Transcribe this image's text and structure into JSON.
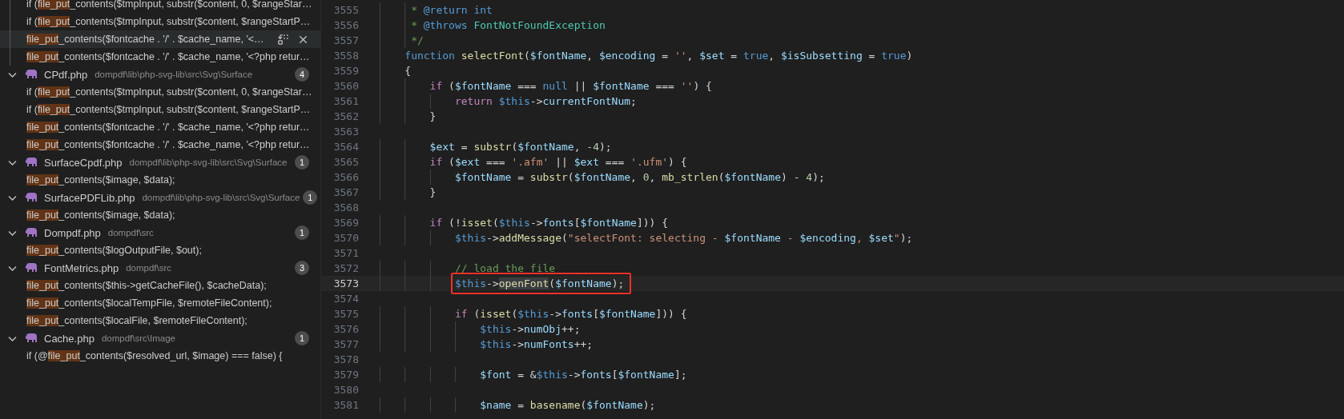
{
  "search_results": {
    "groups": [
      {
        "matches": [
          {
            "before": "if (",
            "match": "file_put",
            "after": "_contents($tmpInput, substr($content, 0, $rangeStar…",
            "selected": false
          },
          {
            "before": "if (",
            "match": "file_put",
            "after": "_contents($tmpInput, substr($content, $rangeStartP…",
            "selected": false
          },
          {
            "match": "file_put",
            "after": "_contents($fontcache . '/' . $cache_name, '<…",
            "selected": true
          },
          {
            "match": "file_put",
            "after": "_contents($fontcache . '/' . $cache_name, '<?php retur…",
            "selected": false
          }
        ]
      },
      {
        "file": "CPdf.php",
        "path": "dompdf\\lib\\php-svg-lib\\src\\Svg\\Surface",
        "count": "4",
        "expanded": true,
        "matches": [
          {
            "before": "if (",
            "match": "file_put",
            "after": "_contents($tmpInput, substr($content, 0, $rangeStar…",
            "selected": false
          },
          {
            "before": "if (",
            "match": "file_put",
            "after": "_contents($tmpInput, substr($content, $rangeStartP…",
            "selected": false
          },
          {
            "match": "file_put",
            "after": "_contents($fontcache . '/' . $cache_name, '<?php retur…",
            "selected": false
          },
          {
            "match": "file_put",
            "after": "_contents($fontcache . '/' . $cache_name, '<?php retur…",
            "selected": false
          }
        ]
      },
      {
        "file": "SurfaceCpdf.php",
        "path": "dompdf\\lib\\php-svg-lib\\src\\Svg\\Surface",
        "count": "1",
        "expanded": true,
        "matches": [
          {
            "match": "file_put",
            "after": "_contents($image, $data);",
            "selected": false
          }
        ]
      },
      {
        "file": "SurfacePDFLib.php",
        "path": "dompdf\\lib\\php-svg-lib\\src\\Svg\\Surface",
        "count": "1",
        "expanded": true,
        "matches": [
          {
            "match": "file_put",
            "after": "_contents($image, $data);",
            "selected": false
          }
        ]
      },
      {
        "file": "Dompdf.php",
        "path": "dompdf\\src",
        "count": "1",
        "expanded": true,
        "matches": [
          {
            "match": "file_put",
            "after": "_contents($logOutputFile, $out);",
            "selected": false
          }
        ]
      },
      {
        "file": "FontMetrics.php",
        "path": "dompdf\\src",
        "count": "3",
        "expanded": true,
        "matches": [
          {
            "match": "file_put",
            "after": "_contents($this->getCacheFile(), $cacheData);",
            "selected": false
          },
          {
            "match": "file_put",
            "after": "_contents($localTempFile, $remoteFileContent);",
            "selected": false
          },
          {
            "match": "file_put",
            "after": "_contents($localFile, $remoteFileContent);",
            "selected": false
          }
        ]
      },
      {
        "file": "Cache.php",
        "path": "dompdf\\src\\Image",
        "count": "1",
        "expanded": true,
        "matches": [
          {
            "before": "if (@",
            "match": "file_put",
            "after": "_contents($resolved_url, $image) === false) {",
            "selected": false
          }
        ]
      }
    ]
  },
  "editor": {
    "lines": [
      {
        "number": "3555",
        "current": false,
        "annotated": false,
        "tokens": [
          {
            "t": "     * ",
            "kind": "comment"
          },
          {
            "t": "@return",
            "kind": "keyword"
          },
          {
            "t": " int",
            "kind": "keyword"
          }
        ]
      },
      {
        "number": "3556",
        "current": false,
        "annotated": false,
        "tokens": [
          {
            "t": "     * ",
            "kind": "comment"
          },
          {
            "t": "@throws",
            "kind": "keyword"
          },
          {
            "t": " FontNotFoundException",
            "kind": "type"
          }
        ]
      },
      {
        "number": "3557",
        "current": false,
        "annotated": false,
        "tokens": [
          {
            "t": "     */",
            "kind": "comment"
          }
        ]
      },
      {
        "number": "3558",
        "current": false,
        "annotated": false,
        "tokens": [
          {
            "t": "    function",
            "kind": "keyword"
          },
          {
            "t": " selectFont",
            "kind": "func"
          },
          {
            "t": "(",
            "kind": "plain"
          },
          {
            "t": "$fontName",
            "kind": "var"
          },
          {
            "t": ", ",
            "kind": "plain"
          },
          {
            "t": "$encoding",
            "kind": "var"
          },
          {
            "t": " = ",
            "kind": "plain"
          },
          {
            "t": "''",
            "kind": "string"
          },
          {
            "t": ", ",
            "kind": "plain"
          },
          {
            "t": "$set",
            "kind": "var"
          },
          {
            "t": " = ",
            "kind": "plain"
          },
          {
            "t": "true",
            "kind": "keyword"
          },
          {
            "t": ", ",
            "kind": "plain"
          },
          {
            "t": "$isSubsetting",
            "kind": "var"
          },
          {
            "t": " = ",
            "kind": "plain"
          },
          {
            "t": "true",
            "kind": "keyword"
          },
          {
            "t": ")",
            "kind": "plain"
          }
        ]
      },
      {
        "number": "3559",
        "current": false,
        "annotated": false,
        "tokens": [
          {
            "t": "    {",
            "kind": "plain"
          }
        ]
      },
      {
        "number": "3560",
        "current": false,
        "annotated": false,
        "tokens": [
          {
            "t": "        if",
            "kind": "control"
          },
          {
            "t": " (",
            "kind": "plain"
          },
          {
            "t": "$fontName",
            "kind": "var"
          },
          {
            "t": " === ",
            "kind": "plain"
          },
          {
            "t": "null",
            "kind": "keyword"
          },
          {
            "t": " || ",
            "kind": "plain"
          },
          {
            "t": "$fontName",
            "kind": "var"
          },
          {
            "t": " === ",
            "kind": "plain"
          },
          {
            "t": "''",
            "kind": "string"
          },
          {
            "t": ") {",
            "kind": "plain"
          }
        ]
      },
      {
        "number": "3561",
        "current": false,
        "annotated": false,
        "tokens": [
          {
            "t": "            return",
            "kind": "control"
          },
          {
            "t": " $this",
            "kind": "keyword"
          },
          {
            "t": "->",
            "kind": "plain"
          },
          {
            "t": "currentFontNum",
            "kind": "var"
          },
          {
            "t": ";",
            "kind": "plain"
          }
        ]
      },
      {
        "number": "3562",
        "current": false,
        "annotated": false,
        "tokens": [
          {
            "t": "        }",
            "kind": "plain"
          }
        ]
      },
      {
        "number": "3563",
        "current": false,
        "annotated": false
      },
      {
        "number": "3564",
        "current": false,
        "annotated": false,
        "tokens": [
          {
            "t": "        $ext",
            "kind": "var"
          },
          {
            "t": " = ",
            "kind": "plain"
          },
          {
            "t": "substr",
            "kind": "func"
          },
          {
            "t": "(",
            "kind": "plain"
          },
          {
            "t": "$fontName",
            "kind": "var"
          },
          {
            "t": ", ",
            "kind": "plain"
          },
          {
            "t": "-4",
            "kind": "number"
          },
          {
            "t": ");",
            "kind": "plain"
          }
        ]
      },
      {
        "number": "3565",
        "current": false,
        "annotated": false,
        "tokens": [
          {
            "t": "        if",
            "kind": "control"
          },
          {
            "t": " (",
            "kind": "plain"
          },
          {
            "t": "$ext",
            "kind": "var"
          },
          {
            "t": " === ",
            "kind": "plain"
          },
          {
            "t": "'.afm'",
            "kind": "string"
          },
          {
            "t": " || ",
            "kind": "plain"
          },
          {
            "t": "$ext",
            "kind": "var"
          },
          {
            "t": " === ",
            "kind": "plain"
          },
          {
            "t": "'.ufm'",
            "kind": "string"
          },
          {
            "t": ") {",
            "kind": "plain"
          }
        ]
      },
      {
        "number": "3566",
        "current": false,
        "annotated": false,
        "tokens": [
          {
            "t": "            $fontName",
            "kind": "var"
          },
          {
            "t": " = ",
            "kind": "plain"
          },
          {
            "t": "substr",
            "kind": "func"
          },
          {
            "t": "(",
            "kind": "plain"
          },
          {
            "t": "$fontName",
            "kind": "var"
          },
          {
            "t": ", ",
            "kind": "plain"
          },
          {
            "t": "0",
            "kind": "number"
          },
          {
            "t": ", ",
            "kind": "plain"
          },
          {
            "t": "mb_strlen",
            "kind": "func"
          },
          {
            "t": "(",
            "kind": "plain"
          },
          {
            "t": "$fontName",
            "kind": "var"
          },
          {
            "t": ") - ",
            "kind": "plain"
          },
          {
            "t": "4",
            "kind": "number"
          },
          {
            "t": ");",
            "kind": "plain"
          }
        ]
      },
      {
        "number": "3567",
        "current": false,
        "annotated": false,
        "tokens": [
          {
            "t": "        }",
            "kind": "plain"
          }
        ]
      },
      {
        "number": "3568",
        "current": false,
        "annotated": false
      },
      {
        "number": "3569",
        "current": false,
        "annotated": false,
        "tokens": [
          {
            "t": "        if",
            "kind": "control"
          },
          {
            "t": " (!",
            "kind": "plain"
          },
          {
            "t": "isset",
            "kind": "func"
          },
          {
            "t": "(",
            "kind": "plain"
          },
          {
            "t": "$this",
            "kind": "keyword"
          },
          {
            "t": "->",
            "kind": "plain"
          },
          {
            "t": "fonts",
            "kind": "var"
          },
          {
            "t": "[",
            "kind": "plain"
          },
          {
            "t": "$fontName",
            "kind": "var"
          },
          {
            "t": "])) {",
            "kind": "plain"
          }
        ]
      },
      {
        "number": "3570",
        "current": false,
        "annotated": false,
        "tokens": [
          {
            "t": "            $this",
            "kind": "keyword"
          },
          {
            "t": "->",
            "kind": "plain"
          },
          {
            "t": "addMessage",
            "kind": "func"
          },
          {
            "t": "(",
            "kind": "plain"
          },
          {
            "t": "\"selectFont: selecting - ",
            "kind": "string"
          },
          {
            "t": "$fontName",
            "kind": "var"
          },
          {
            "t": " - ",
            "kind": "string"
          },
          {
            "t": "$encoding",
            "kind": "var"
          },
          {
            "t": ", ",
            "kind": "string"
          },
          {
            "t": "$set",
            "kind": "var"
          },
          {
            "t": "\"",
            "kind": "string"
          },
          {
            "t": ");",
            "kind": "plain"
          }
        ]
      },
      {
        "number": "3571",
        "current": false,
        "annotated": false
      },
      {
        "number": "3572",
        "current": false,
        "annotated": false,
        "tokens": [
          {
            "t": "            // load the file",
            "kind": "comment"
          }
        ]
      },
      {
        "number": "3573",
        "current": true,
        "annotated": true,
        "tokens": [
          {
            "t": "            $this",
            "kind": "keyword"
          },
          {
            "t": "->",
            "kind": "plain"
          },
          {
            "t": "openFont",
            "kind": "selected"
          },
          {
            "t": "(",
            "kind": "plain"
          },
          {
            "t": "$fontName",
            "kind": "var"
          },
          {
            "t": ");",
            "kind": "plain"
          }
        ]
      },
      {
        "number": "3574",
        "current": false,
        "annotated": false
      },
      {
        "number": "3575",
        "current": false,
        "annotated": false,
        "tokens": [
          {
            "t": "            if",
            "kind": "control"
          },
          {
            "t": " (",
            "kind": "plain"
          },
          {
            "t": "isset",
            "kind": "func"
          },
          {
            "t": "(",
            "kind": "plain"
          },
          {
            "t": "$this",
            "kind": "keyword"
          },
          {
            "t": "->",
            "kind": "plain"
          },
          {
            "t": "fonts",
            "kind": "var"
          },
          {
            "t": "[",
            "kind": "plain"
          },
          {
            "t": "$fontName",
            "kind": "var"
          },
          {
            "t": "])) {",
            "kind": "plain"
          }
        ]
      },
      {
        "number": "3576",
        "current": false,
        "annotated": false,
        "tokens": [
          {
            "t": "                $this",
            "kind": "keyword"
          },
          {
            "t": "->",
            "kind": "plain"
          },
          {
            "t": "numObj",
            "kind": "var"
          },
          {
            "t": "++;",
            "kind": "plain"
          }
        ]
      },
      {
        "number": "3577",
        "current": false,
        "annotated": false,
        "tokens": [
          {
            "t": "                $this",
            "kind": "keyword"
          },
          {
            "t": "->",
            "kind": "plain"
          },
          {
            "t": "numFonts",
            "kind": "var"
          },
          {
            "t": "++;",
            "kind": "plain"
          }
        ]
      },
      {
        "number": "3578",
        "current": false,
        "annotated": false
      },
      {
        "number": "3579",
        "current": false,
        "annotated": false,
        "tokens": [
          {
            "t": "                $font",
            "kind": "var"
          },
          {
            "t": " = &",
            "kind": "plain"
          },
          {
            "t": "$this",
            "kind": "keyword"
          },
          {
            "t": "->",
            "kind": "plain"
          },
          {
            "t": "fonts",
            "kind": "var"
          },
          {
            "t": "[",
            "kind": "plain"
          },
          {
            "t": "$fontName",
            "kind": "var"
          },
          {
            "t": "];",
            "kind": "plain"
          }
        ]
      },
      {
        "number": "3580",
        "current": false,
        "annotated": false
      },
      {
        "number": "3581",
        "current": false,
        "annotated": false,
        "tokens": [
          {
            "t": "                $name",
            "kind": "var"
          },
          {
            "t": " = ",
            "kind": "plain"
          },
          {
            "t": "basename",
            "kind": "func"
          },
          {
            "t": "(",
            "kind": "plain"
          },
          {
            "t": "$fontName",
            "kind": "var"
          },
          {
            "t": ");",
            "kind": "plain"
          }
        ]
      }
    ]
  }
}
